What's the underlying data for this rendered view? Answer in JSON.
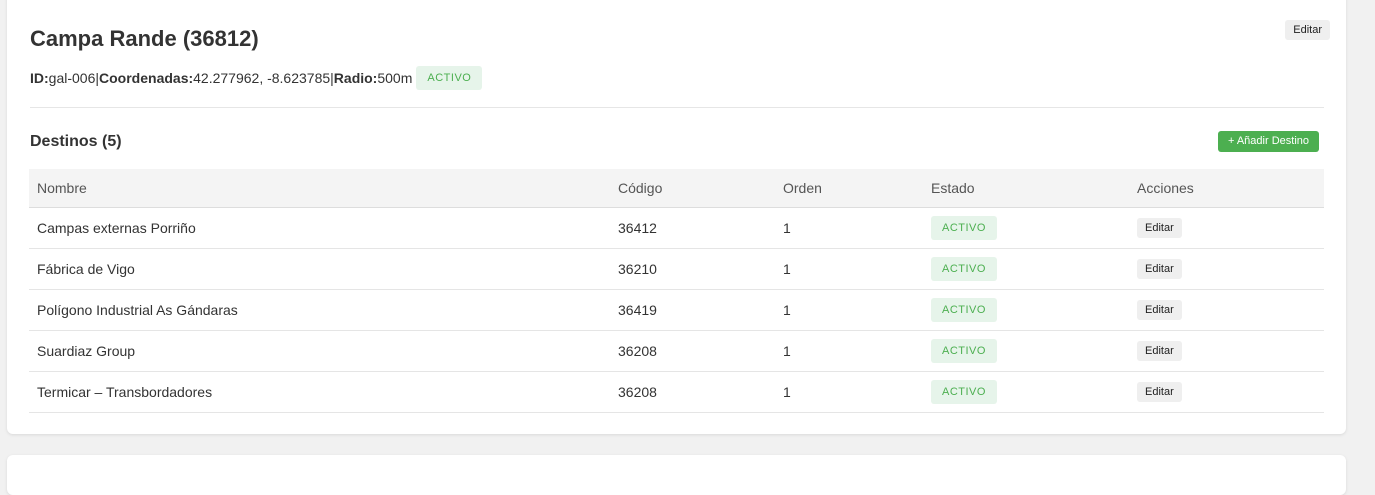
{
  "location": {
    "title": "Campa Rande (36812)",
    "edit_label": "Editar",
    "id_label": "ID:",
    "id_value": "gal-006",
    "coords_label": "Coordenadas:",
    "coords_value": "42.277962, -8.623785",
    "radius_label": "Radio:",
    "radius_value": "500m",
    "status": "ACTIVO",
    "separator": "|"
  },
  "destinations": {
    "title": "Destinos (5)",
    "add_label": "+ Añadir Destino",
    "columns": [
      "Nombre",
      "Código",
      "Orden",
      "Estado",
      "Acciones"
    ],
    "rows": [
      {
        "nombre": "Campas externas Porriño",
        "codigo": "36412",
        "orden": "1",
        "estado": "ACTIVO",
        "accion": "Editar"
      },
      {
        "nombre": "Fábrica de Vigo",
        "codigo": "36210",
        "orden": "1",
        "estado": "ACTIVO",
        "accion": "Editar"
      },
      {
        "nombre": "Polígono Industrial As Gándaras",
        "codigo": "36419",
        "orden": "1",
        "estado": "ACTIVO",
        "accion": "Editar"
      },
      {
        "nombre": "Suardiaz Group",
        "codigo": "36208",
        "orden": "1",
        "estado": "ACTIVO",
        "accion": "Editar"
      },
      {
        "nombre": "Termicar – Transbordadores",
        "codigo": "36208",
        "orden": "1",
        "estado": "ACTIVO",
        "accion": "Editar"
      }
    ]
  },
  "colors": {
    "active_badge_bg": "#e6f4ea",
    "active_badge_text": "#4caf50",
    "add_button": "#4caf50",
    "page_bg": "#f1f1f1"
  }
}
